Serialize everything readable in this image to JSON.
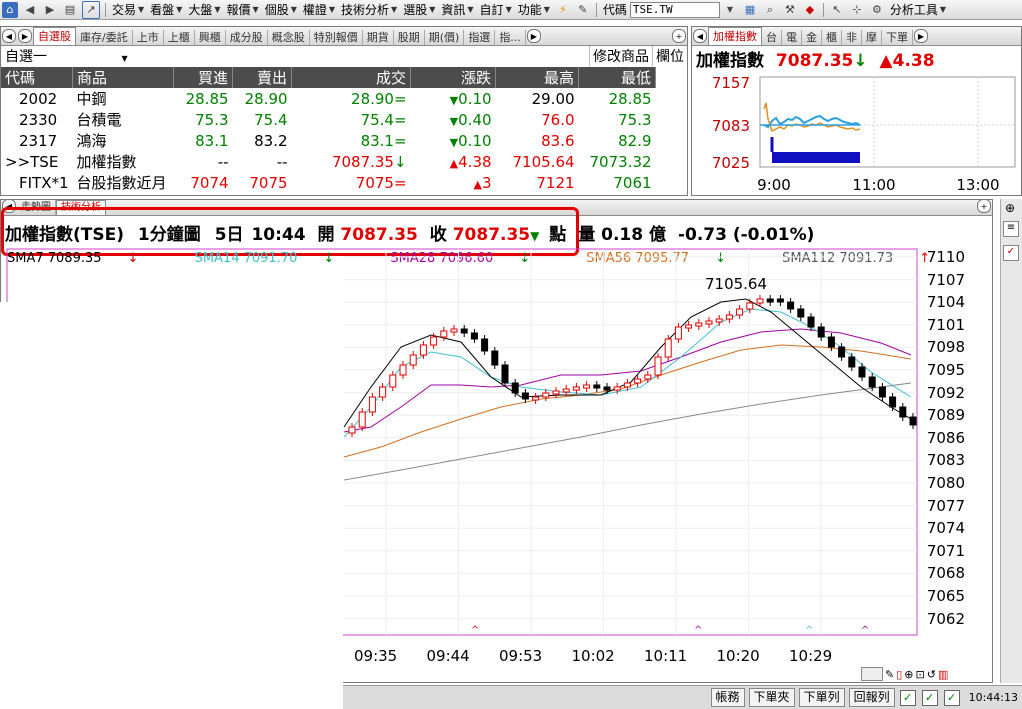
{
  "menubar": {
    "items": [
      "交易",
      "看盤",
      "大盤",
      "報價",
      "個股",
      "權證",
      "技術分析",
      "選股",
      "資訊",
      "自訂",
      "功能"
    ],
    "symbol_label": "代碼",
    "symbol_value": "TSE.TW",
    "analysis_tools": "分析工具"
  },
  "quote_tabs": [
    "自選股",
    "庫存/委託",
    "上市",
    "上櫃",
    "興櫃",
    "成分股",
    "概念股",
    "特別報價",
    "期貨",
    "股期",
    "期(價)",
    "指選",
    "指..."
  ],
  "quote_toolbar": {
    "group": "自選一",
    "edit": "修改商品",
    "columns": "欄位"
  },
  "quote_table": {
    "headers": [
      "代碼",
      "商品",
      "買進",
      "賣出",
      "成交",
      "漲跌",
      "最高",
      "最低"
    ],
    "rows": [
      {
        "code": "2002",
        "name": "中鋼",
        "bid": "28.85",
        "ask": "28.90",
        "last": "28.90=",
        "chg": "0.10",
        "high": "29.00",
        "low": "28.85",
        "dir": "down"
      },
      {
        "code": "2330",
        "name": "台積電",
        "bid": "75.3",
        "ask": "75.4",
        "last": "75.4=",
        "chg": "0.40",
        "high": "76.0",
        "low": "75.3",
        "dir": "down"
      },
      {
        "code": "2317",
        "name": "鴻海",
        "bid": "83.1",
        "ask": "83.2",
        "last": "83.1=",
        "chg": "0.10",
        "high": "83.6",
        "low": "82.9",
        "dir": "down"
      },
      {
        "code": ">>TSE",
        "name": "加權指數",
        "bid": "--",
        "ask": "--",
        "last": "7087.35",
        "chg": "4.38",
        "high": "7105.64",
        "low": "7073.32",
        "dir": "up"
      },
      {
        "code": "FITX*1",
        "name": "台股指數近月",
        "bid": "7074",
        "ask": "7075",
        "last": "7075=",
        "chg": "3",
        "high": "7121",
        "low": "7061",
        "dir": "up"
      }
    ]
  },
  "mini_tabs": [
    "加權指數",
    "台",
    "電",
    "金",
    "櫃",
    "非",
    "摩",
    "下單"
  ],
  "mini_chart": {
    "title": "加權指數",
    "price": "7087.35",
    "change": "4.38",
    "y_ticks": [
      "7157",
      "7083",
      "7025"
    ],
    "x_ticks": [
      "9:00",
      "11:00",
      "13:00"
    ]
  },
  "main_tabs": [
    "走勢圖",
    "技術分析"
  ],
  "info_line": {
    "symbol": "加權指數(TSE)",
    "period": "1分鐘圖",
    "days": "5日",
    "time": "10:44",
    "open_label": "開",
    "open": "7087.35",
    "close_label": "收",
    "close": "7087.35",
    "unit": "點",
    "vol_label": "量",
    "volume": "0.18",
    "vol_unit": "億",
    "change": "-0.73 (-0.01%)"
  },
  "sma": [
    {
      "label": "SMA7 7089.35",
      "color": "#000000",
      "dir": "down"
    },
    {
      "label": "SMA14 7091.70",
      "color": "#3fbfd0",
      "dir": "down"
    },
    {
      "label": "SMA28 7096.60",
      "color": "#a000a0",
      "dir": "down"
    },
    {
      "label": "SMA56 7095.77",
      "color": "#d07020",
      "dir": "down"
    },
    {
      "label": "SMA112 7091.73",
      "color": "#808080",
      "dir": "up"
    }
  ],
  "chart_data": {
    "type": "candlestick",
    "price_ticks": [
      "7110",
      "7107",
      "7104",
      "7101",
      "7098",
      "7095",
      "7092",
      "7089",
      "7086",
      "7083",
      "7080",
      "7077",
      "7074",
      "7071",
      "7068",
      "7065",
      "7062"
    ],
    "time_ticks": [
      "09:35",
      "09:44",
      "09:53",
      "10:02",
      "10:11",
      "10:20",
      "10:29"
    ],
    "high_label": "7105.64",
    "ylim": [
      7060,
      7111
    ]
  },
  "status": {
    "buttons": [
      "帳務",
      "下單夾",
      "下單列",
      "回報列"
    ],
    "clock": "10:44:13"
  },
  "colors": {
    "up": "#e00000",
    "down": "#008000",
    "accent": "#c00000"
  }
}
